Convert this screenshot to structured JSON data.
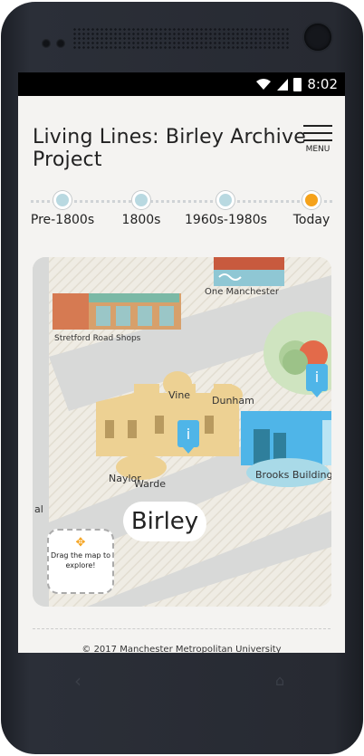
{
  "status_bar": {
    "time": "8:02"
  },
  "header": {
    "title": "Living Lines: Birley Archive Project",
    "menu_label": "MENU"
  },
  "timeline": {
    "items": [
      {
        "label": "Pre-1800s",
        "active": false
      },
      {
        "label": "1800s",
        "active": false
      },
      {
        "label": "1960s-1980s",
        "active": false
      },
      {
        "label": "Today",
        "active": true
      }
    ]
  },
  "map": {
    "labels": {
      "one_manchester": "One Manchester",
      "stretford_road_shops": "Stretford Road Shops",
      "vine": "Vine",
      "dunham": "Dunham",
      "naylor": "Naylor",
      "warde": "Warde",
      "brooks_building": "Brooks Building",
      "birley": "Birley",
      "edge_fragment": "al"
    },
    "drag_hint": "Drag the map to explore!",
    "info_marker_glyph": "i"
  },
  "footer": {
    "copyright": "© 2017 Manchester Metropolitan University"
  },
  "colors": {
    "accent_orange": "#f5a21b",
    "timeline_dot": "#b9d9e1",
    "info_blue": "#4fb5e8"
  }
}
